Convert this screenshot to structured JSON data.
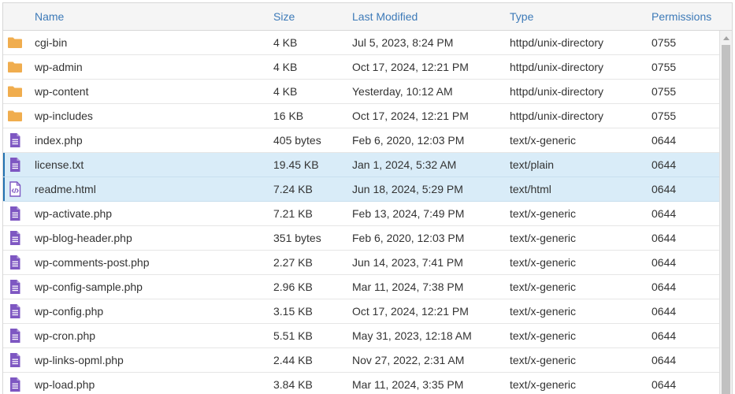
{
  "columns": {
    "name": "Name",
    "size": "Size",
    "modified": "Last Modified",
    "type": "Type",
    "permissions": "Permissions"
  },
  "colors": {
    "folder": "#f0ad4e",
    "file": "#7e57c2",
    "header_text": "#3d7ab8",
    "selected_row": "#d9ecf8"
  },
  "files": [
    {
      "icon": "folder-icon",
      "name": "cgi-bin",
      "size": "4 KB",
      "modified": "Jul 5, 2023, 8:24 PM",
      "type": "httpd/unix-directory",
      "perms": "0755",
      "selected": false
    },
    {
      "icon": "folder-icon",
      "name": "wp-admin",
      "size": "4 KB",
      "modified": "Oct 17, 2024, 12:21 PM",
      "type": "httpd/unix-directory",
      "perms": "0755",
      "selected": false
    },
    {
      "icon": "folder-icon",
      "name": "wp-content",
      "size": "4 KB",
      "modified": "Yesterday, 10:12 AM",
      "type": "httpd/unix-directory",
      "perms": "0755",
      "selected": false
    },
    {
      "icon": "folder-icon",
      "name": "wp-includes",
      "size": "16 KB",
      "modified": "Oct 17, 2024, 12:21 PM",
      "type": "httpd/unix-directory",
      "perms": "0755",
      "selected": false
    },
    {
      "icon": "file-text-icon",
      "name": "index.php",
      "size": "405 bytes",
      "modified": "Feb 6, 2020, 12:03 PM",
      "type": "text/x-generic",
      "perms": "0644",
      "selected": false
    },
    {
      "icon": "file-text-icon",
      "name": "license.txt",
      "size": "19.45 KB",
      "modified": "Jan 1, 2024, 5:32 AM",
      "type": "text/plain",
      "perms": "0644",
      "selected": true
    },
    {
      "icon": "file-code-icon",
      "name": "readme.html",
      "size": "7.24 KB",
      "modified": "Jun 18, 2024, 5:29 PM",
      "type": "text/html",
      "perms": "0644",
      "selected": true
    },
    {
      "icon": "file-text-icon",
      "name": "wp-activate.php",
      "size": "7.21 KB",
      "modified": "Feb 13, 2024, 7:49 PM",
      "type": "text/x-generic",
      "perms": "0644",
      "selected": false
    },
    {
      "icon": "file-text-icon",
      "name": "wp-blog-header.php",
      "size": "351 bytes",
      "modified": "Feb 6, 2020, 12:03 PM",
      "type": "text/x-generic",
      "perms": "0644",
      "selected": false
    },
    {
      "icon": "file-text-icon",
      "name": "wp-comments-post.php",
      "size": "2.27 KB",
      "modified": "Jun 14, 2023, 7:41 PM",
      "type": "text/x-generic",
      "perms": "0644",
      "selected": false
    },
    {
      "icon": "file-text-icon",
      "name": "wp-config-sample.php",
      "size": "2.96 KB",
      "modified": "Mar 11, 2024, 7:38 PM",
      "type": "text/x-generic",
      "perms": "0644",
      "selected": false
    },
    {
      "icon": "file-text-icon",
      "name": "wp-config.php",
      "size": "3.15 KB",
      "modified": "Oct 17, 2024, 12:21 PM",
      "type": "text/x-generic",
      "perms": "0644",
      "selected": false
    },
    {
      "icon": "file-text-icon",
      "name": "wp-cron.php",
      "size": "5.51 KB",
      "modified": "May 31, 2023, 12:18 AM",
      "type": "text/x-generic",
      "perms": "0644",
      "selected": false
    },
    {
      "icon": "file-text-icon",
      "name": "wp-links-opml.php",
      "size": "2.44 KB",
      "modified": "Nov 27, 2022, 2:31 AM",
      "type": "text/x-generic",
      "perms": "0644",
      "selected": false
    },
    {
      "icon": "file-text-icon",
      "name": "wp-load.php",
      "size": "3.84 KB",
      "modified": "Mar 11, 2024, 3:35 PM",
      "type": "text/x-generic",
      "perms": "0644",
      "selected": false
    }
  ]
}
